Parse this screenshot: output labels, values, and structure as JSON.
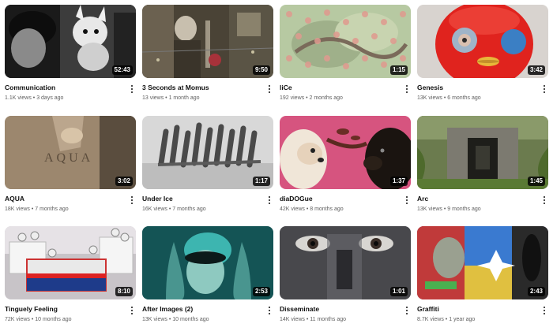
{
  "videos": [
    {
      "title": "Communication",
      "views": "1.1K views",
      "age": "3 days ago",
      "duration": "52:43",
      "icon": "more-vert-icon"
    },
    {
      "title": "3 Seconds at Momus",
      "views": "13 views",
      "age": "1 month ago",
      "duration": "9:50",
      "icon": "more-vert-icon"
    },
    {
      "title": "liCe",
      "views": "192 views",
      "age": "2 months ago",
      "duration": "1:15",
      "icon": "more-vert-icon"
    },
    {
      "title": "Genesis",
      "views": "13K views",
      "age": "6 months ago",
      "duration": "3:42",
      "icon": "more-vert-icon"
    },
    {
      "title": "AQUA",
      "views": "18K views",
      "age": "7 months ago",
      "duration": "3:02",
      "icon": "more-vert-icon"
    },
    {
      "title": "Under Ice",
      "views": "16K views",
      "age": "7 months ago",
      "duration": "1:17",
      "icon": "more-vert-icon"
    },
    {
      "title": "diaDOGue",
      "views": "42K views",
      "age": "8 months ago",
      "duration": "1:37",
      "icon": "more-vert-icon"
    },
    {
      "title": "Arc",
      "views": "13K views",
      "age": "9 months ago",
      "duration": "1:45",
      "icon": "more-vert-icon"
    },
    {
      "title": "Tinguely Feeling",
      "views": "72K views",
      "age": "10 months ago",
      "duration": "8:10",
      "icon": "more-vert-icon"
    },
    {
      "title": "After Images (2)",
      "views": "13K views",
      "age": "10 months ago",
      "duration": "2:53",
      "icon": "more-vert-icon"
    },
    {
      "title": "Disseminate",
      "views": "14K views",
      "age": "11 months ago",
      "duration": "1:01",
      "icon": "more-vert-icon"
    },
    {
      "title": "Graffiti",
      "views": "8.7K views",
      "age": "1 year ago",
      "duration": "2:43",
      "icon": "more-vert-icon"
    }
  ],
  "thumbnail_text": {
    "aqua_overlay": "AQUA"
  },
  "colors": {
    "duration_badge_bg": "#000000",
    "duration_text": "#ffffff",
    "title_text": "#0f0f0f",
    "meta_text": "#606060"
  }
}
